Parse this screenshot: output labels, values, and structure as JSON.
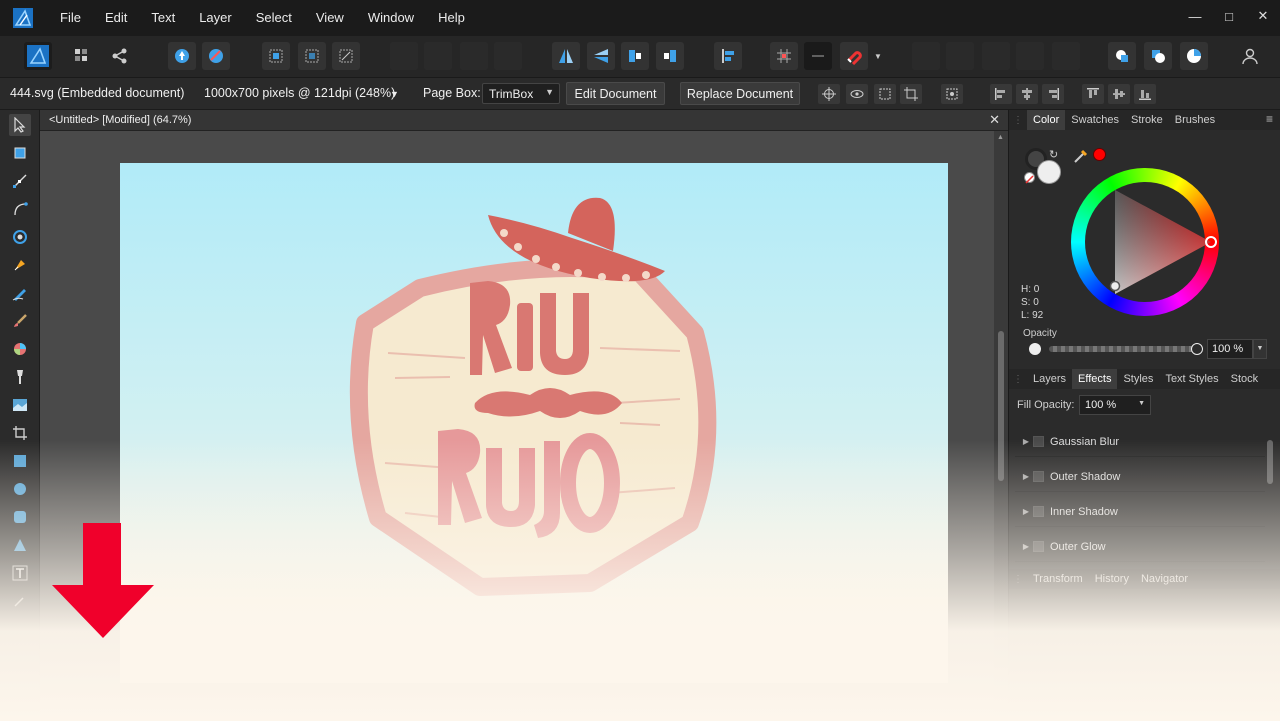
{
  "menubar": {
    "items": [
      "File",
      "Edit",
      "Text",
      "Layer",
      "Select",
      "View",
      "Window",
      "Help"
    ],
    "window_controls": [
      "minimize",
      "maximize",
      "close"
    ]
  },
  "contextbar": {
    "doc_name": "444.svg (Embedded document)",
    "doc_size": "1000x700 pixels @ 121dpi (248%)",
    "page_box_label": "Page Box:",
    "page_box_value": "TrimBox",
    "edit_document": "Edit Document",
    "replace_document": "Replace Document"
  },
  "canvas": {
    "tab_title": "<Untitled> [Modified] (64.7%)",
    "logo_colors": {
      "red": "#d4645c",
      "cream": "#f6ead0"
    }
  },
  "color_panel": {
    "tabs": [
      "Color",
      "Swatches",
      "Stroke",
      "Brushes"
    ],
    "active_tab": "Color",
    "hsl": {
      "h": "H: 0",
      "s": "S: 0",
      "l": "L: 92"
    },
    "opacity_label": "Opacity",
    "opacity_value": "100 %"
  },
  "effects_panel": {
    "tabs": [
      "Layers",
      "Effects",
      "Styles",
      "Text Styles",
      "Stock"
    ],
    "active_tab": "Effects",
    "fill_opacity_label": "Fill Opacity:",
    "fill_opacity_value": "100 %",
    "effects": [
      "Gaussian Blur",
      "Outer Shadow",
      "Inner Shadow",
      "Outer Glow"
    ]
  },
  "transform_panel": {
    "tabs": [
      "Transform",
      "History",
      "Navigator"
    ]
  },
  "colors": {
    "accent": "#3fa1e8",
    "arrow": "#f0002b",
    "selected_color": "#ff0000"
  }
}
